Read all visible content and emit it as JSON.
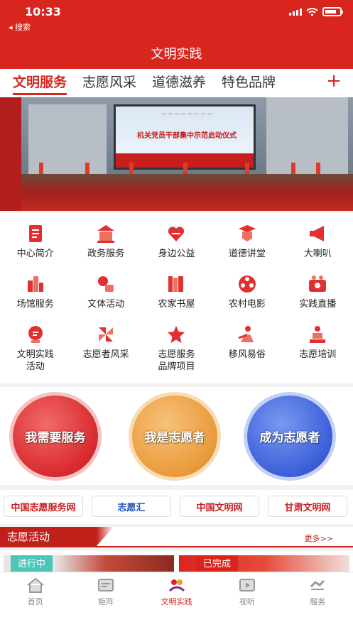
{
  "status_bar": {
    "time": "10:33",
    "back_label": "◂ 搜索"
  },
  "header": {
    "title": "文明实践"
  },
  "tabs": [
    {
      "label": "文明服务",
      "active": true
    },
    {
      "label": "志愿风采"
    },
    {
      "label": "道德滋养"
    },
    {
      "label": "特色品牌"
    }
  ],
  "tab_plus": "+",
  "banner": {
    "screen_title": "机关党员干部集中示范启动仪式"
  },
  "services": [
    {
      "label": "中心简介",
      "icon": "document-icon"
    },
    {
      "label": "政务服务",
      "icon": "government-icon"
    },
    {
      "label": "身边公益",
      "icon": "heart-hand-icon"
    },
    {
      "label": "道德讲堂",
      "icon": "lecture-icon"
    },
    {
      "label": "大喇叭",
      "icon": "megaphone-icon"
    },
    {
      "label": "场馆服务",
      "icon": "venue-icon"
    },
    {
      "label": "文体活动",
      "icon": "sports-icon"
    },
    {
      "label": "农家书屋",
      "icon": "books-icon"
    },
    {
      "label": "农村电影",
      "icon": "film-reel-icon"
    },
    {
      "label": "实践直播",
      "icon": "live-camera-icon"
    },
    {
      "label": "文明实践\n活动",
      "icon": "activity-icon"
    },
    {
      "label": "志愿者风采",
      "icon": "pinwheel-icon"
    },
    {
      "label": "志愿服务\n品牌项目",
      "icon": "star-icon"
    },
    {
      "label": "移风易俗",
      "icon": "person-icon"
    },
    {
      "label": "志愿培训",
      "icon": "training-icon"
    }
  ],
  "big_buttons": [
    {
      "label": "我需要服务",
      "color": "#e0393c"
    },
    {
      "label": "我是志愿者",
      "color": "#e89a3a"
    },
    {
      "label": "成为志愿者",
      "color": "#3a5fd8"
    }
  ],
  "links": [
    {
      "label": "中国志愿服务网",
      "color": "#c81e1e"
    },
    {
      "label": "志愿汇",
      "color": "#1e55b4"
    },
    {
      "label": "中国文明网",
      "color": "#c81e1e"
    },
    {
      "label": "甘肃文明网",
      "color": "#c81e1e"
    }
  ],
  "activities": {
    "title": "志愿活动",
    "more": "更多>>",
    "cards": [
      {
        "status": "进行中",
        "color": "#4cc6b8"
      },
      {
        "status": "已完成",
        "color": "#d8261f"
      }
    ]
  },
  "bottom_nav": [
    {
      "label": "首页",
      "icon": "home-icon"
    },
    {
      "label": "矩阵",
      "icon": "matrix-icon"
    },
    {
      "label": "文明实践",
      "icon": "civilization-icon",
      "active": true
    },
    {
      "label": "视听",
      "icon": "video-icon"
    },
    {
      "label": "服务",
      "icon": "service-icon"
    }
  ],
  "colors": {
    "brand": "#d8261f",
    "nav_inactive": "#888888"
  }
}
